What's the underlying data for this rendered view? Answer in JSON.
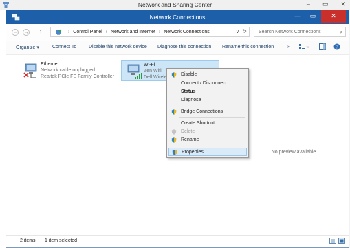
{
  "background_window": {
    "title": "Network and Sharing Center",
    "controls": [
      "–",
      "▭",
      "✕"
    ]
  },
  "window": {
    "title": "Network Connections",
    "controls": {
      "minimize": "—",
      "maximize": "▭",
      "close": "✕"
    }
  },
  "navigation": {
    "back": "←",
    "forward": "→",
    "up": "↑",
    "breadcrumb": [
      "Control Panel",
      "Network and Internet",
      "Network Connections"
    ],
    "separator": "›",
    "dropdown": "∨",
    "refresh": "↻"
  },
  "search": {
    "placeholder": "Search Network Connections",
    "value": "",
    "icon": "search-icon"
  },
  "toolbar": {
    "organize": "Organize ▾",
    "connect_to": "Connect To",
    "disable": "Disable this network device",
    "diagnose": "Diagnose this connection",
    "rename": "Rename this connection",
    "more": "»"
  },
  "adapters": [
    {
      "name": "Ethernet",
      "status": "Network cable unplugged",
      "device": "Realtek PCIe FE Family Controller",
      "icon": "ethernet-adapter-icon"
    },
    {
      "name": "Wi-Fi",
      "status": "Zen Wifi",
      "device": "Dell Wireless 1502 802.11b/g/n",
      "icon": "wifi-adapter-icon"
    }
  ],
  "context_menu": {
    "items": [
      {
        "label": "Disable",
        "shield": true
      },
      {
        "label": "Connect / Disconnect"
      },
      {
        "label": "Status",
        "bold": true
      },
      {
        "label": "Diagnose"
      },
      {
        "label": "Bridge Connections",
        "shield": true
      },
      {
        "label": "Create Shortcut"
      },
      {
        "label": "Delete",
        "shield": true,
        "disabled": true
      },
      {
        "label": "Rename",
        "shield": true
      },
      {
        "label": "Properties",
        "shield": true,
        "highlighted": true
      }
    ]
  },
  "preview": {
    "text": "No preview available."
  },
  "status_bar": {
    "items_count": "2 items",
    "selected": "1 item selected"
  },
  "colors": {
    "titlebar": "#1d5fa8",
    "close_button": "#c9302c",
    "selection": "#cde6f7",
    "menu_highlight": "#d9eaf8",
    "link_text": "#1e3f66"
  }
}
